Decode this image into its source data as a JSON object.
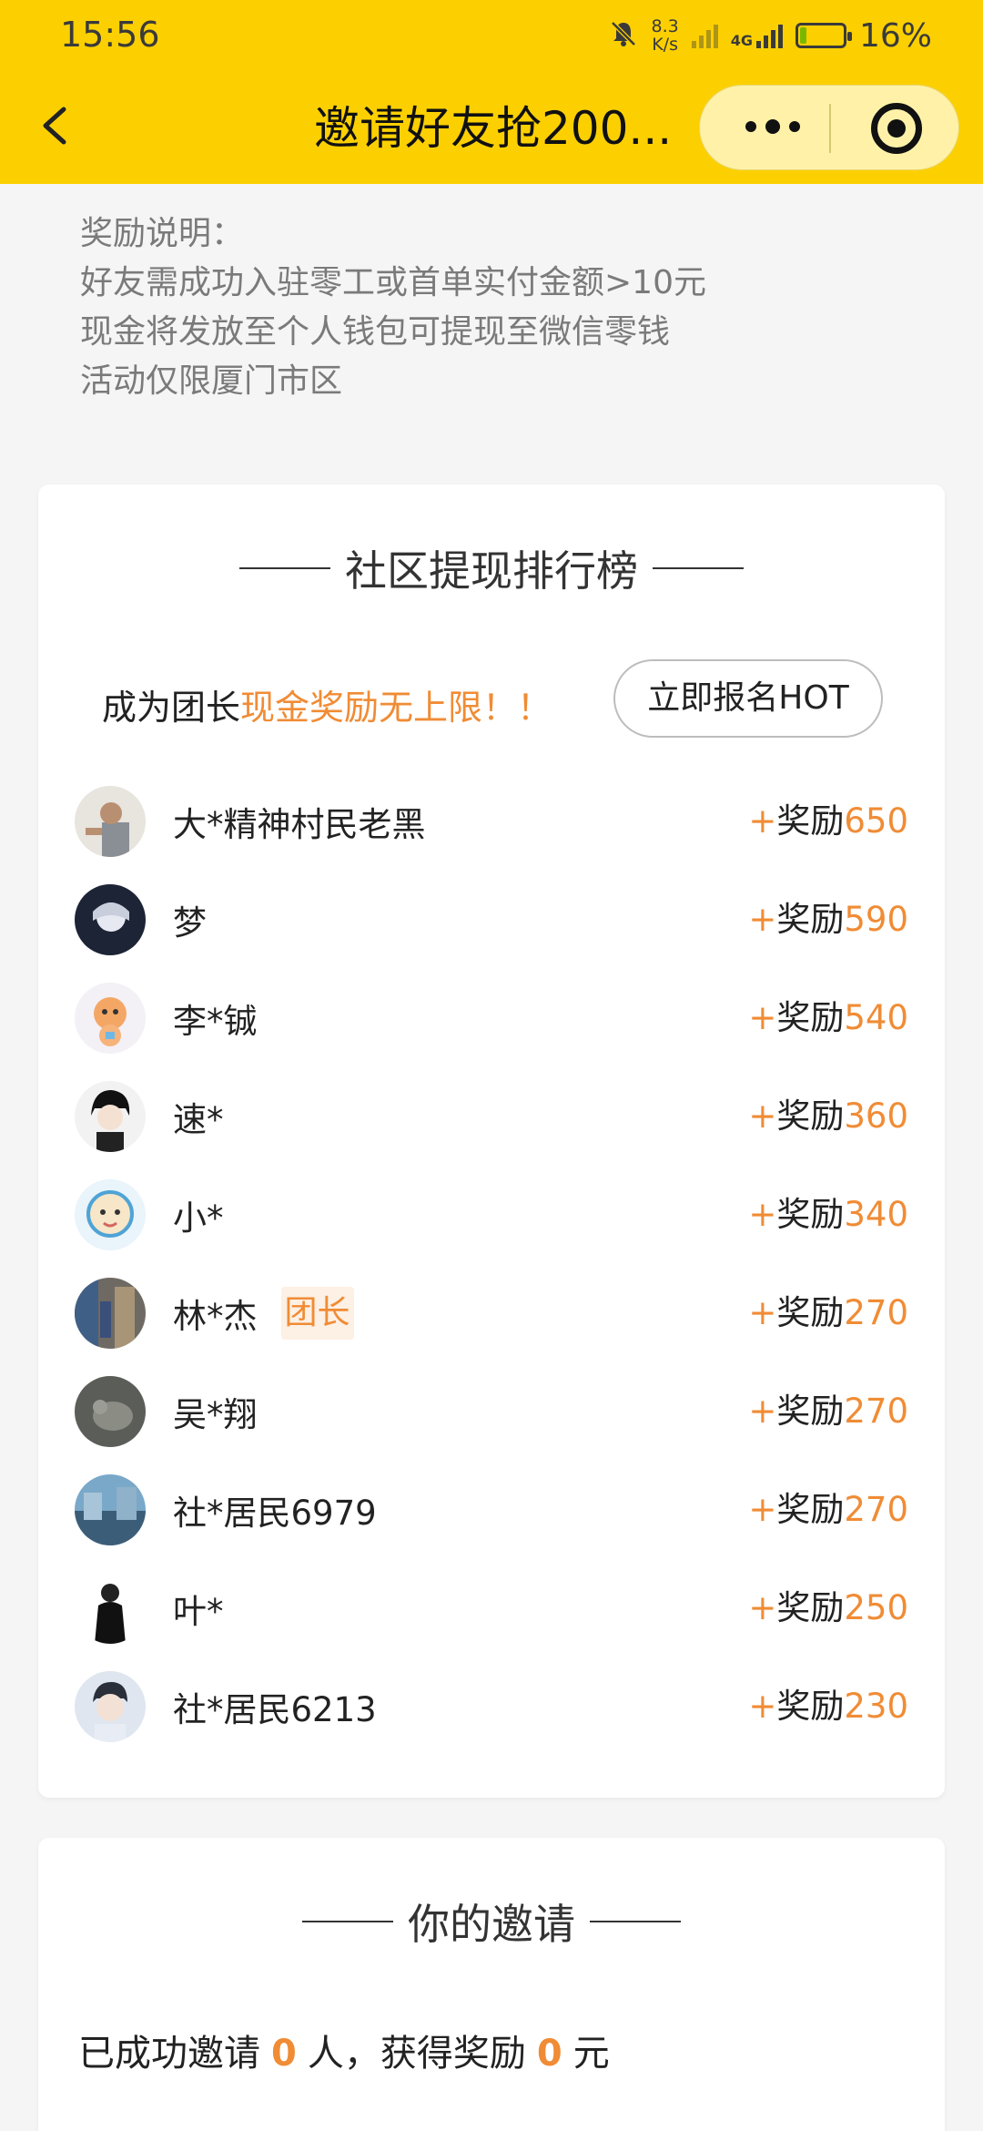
{
  "status_bar": {
    "time": "15:56",
    "net_speed_value": "8.3",
    "net_speed_unit": "K/s",
    "network_label": "4G",
    "battery_percent": "16%",
    "battery_level": 0.16
  },
  "navbar": {
    "title": "邀请好友抢200..."
  },
  "reward_info": {
    "lines": [
      "奖励说明：",
      "好友需成功入驻零工或首单实付金额>10元",
      "现金将发放至个人钱包可提现至微信零钱",
      "活动仅限厦门市区"
    ]
  },
  "ranking": {
    "title": "社区提现排行榜",
    "promo_prefix": "成为团长",
    "promo_highlight": "现金奖励无上限！！",
    "signup_button": "立即报名HOT",
    "reward_plus": "+",
    "reward_label": "奖励",
    "items": [
      {
        "name": "大*精神村民老黑",
        "amount": "650",
        "badge": "",
        "avatar": "person-photo"
      },
      {
        "name": "梦",
        "amount": "590",
        "badge": "",
        "avatar": "anime-character"
      },
      {
        "name": "李*铖",
        "amount": "540",
        "badge": "",
        "avatar": "cartoon-toy"
      },
      {
        "name": "速*",
        "amount": "360",
        "badge": "",
        "avatar": "anime-boy"
      },
      {
        "name": "小*",
        "amount": "340",
        "badge": "",
        "avatar": "cartoon-baby"
      },
      {
        "name": "林*杰",
        "amount": "270",
        "badge": "团长",
        "avatar": "street-photo"
      },
      {
        "name": "吴*翔",
        "amount": "270",
        "badge": "",
        "avatar": "animal-photo"
      },
      {
        "name": "社*居民6979",
        "amount": "270",
        "badge": "",
        "avatar": "building-photo"
      },
      {
        "name": "叶*",
        "amount": "250",
        "badge": "",
        "avatar": "person-black"
      },
      {
        "name": "社*居民6213",
        "amount": "230",
        "badge": "",
        "avatar": "boy-portrait"
      }
    ]
  },
  "invite": {
    "title": "你的邀请",
    "prefix": "已成功邀请",
    "count": "0",
    "middle": "人，获得奖励",
    "reward": "0",
    "suffix": "元"
  },
  "colors": {
    "brand_yellow": "#fcd000",
    "accent_orange": "#f08c35"
  }
}
